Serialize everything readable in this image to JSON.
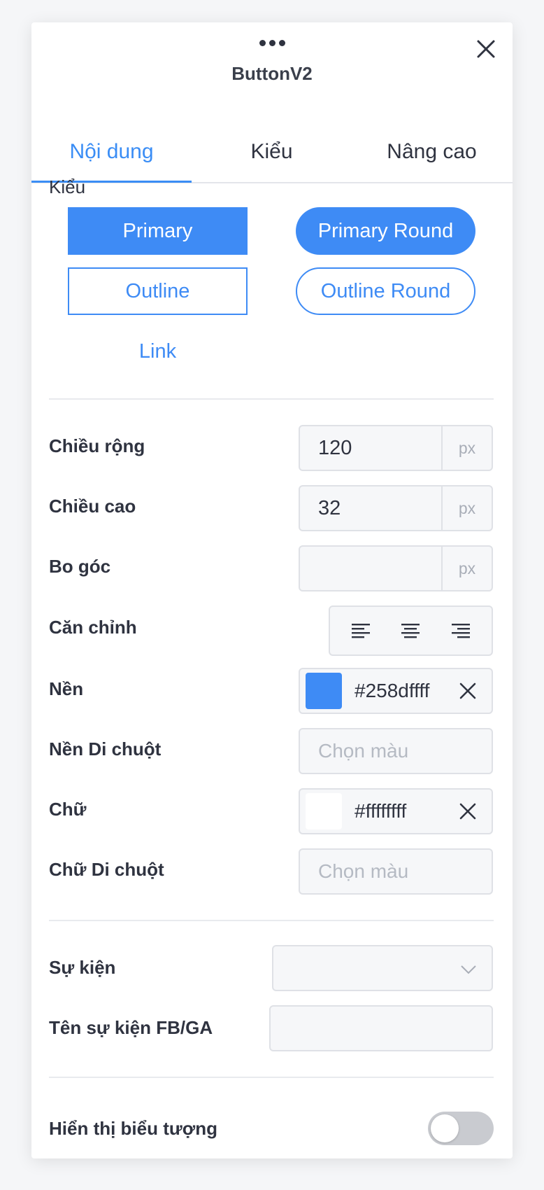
{
  "header": {
    "title": "ButtonV2"
  },
  "tabs": [
    {
      "label": "Nội dung",
      "active": true
    },
    {
      "label": "Kiểu",
      "active": false
    },
    {
      "label": "Nâng cao",
      "active": false
    }
  ],
  "style_section": {
    "label": "Kiểu",
    "options": {
      "primary": "Primary",
      "primary_round": "Primary Round",
      "outline": "Outline",
      "outline_round": "Outline Round",
      "link": "Link"
    }
  },
  "dimensions": {
    "width": {
      "label": "Chiều rộng",
      "value": "120",
      "unit": "px"
    },
    "height": {
      "label": "Chiều cao",
      "value": "32",
      "unit": "px"
    },
    "radius": {
      "label": "Bo góc",
      "value": "",
      "unit": "px"
    },
    "align": {
      "label": "Căn chỉnh",
      "options": [
        "left",
        "center",
        "right"
      ]
    }
  },
  "colors": {
    "background": {
      "label": "Nền",
      "value": "#258dffff",
      "swatch": "#3e8bf5"
    },
    "background_hover": {
      "label": "Nền Di chuột",
      "placeholder": "Chọn màu"
    },
    "text": {
      "label": "Chữ",
      "value": "#ffffffff",
      "swatch": "#ffffff"
    },
    "text_hover": {
      "label": "Chữ Di chuột",
      "placeholder": "Chọn màu"
    }
  },
  "events": {
    "event": {
      "label": "Sự kiện",
      "value": ""
    },
    "event_name": {
      "label": "Tên sự kiện FB/GA",
      "value": ""
    }
  },
  "icon_toggle": {
    "label": "Hiển thị biểu tượng",
    "on": false
  },
  "theme": {
    "accent": "#3e8bf5",
    "text": "#2f3340",
    "border": "#dfe1e6"
  }
}
